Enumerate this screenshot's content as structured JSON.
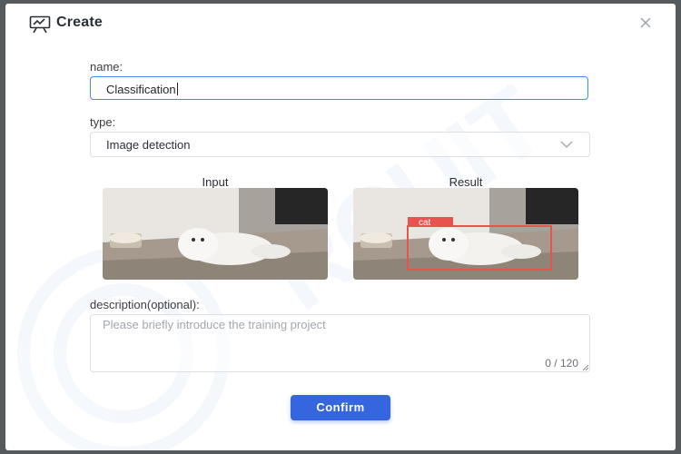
{
  "dialog": {
    "title": "Create",
    "header_icon": "presentation-chart-icon",
    "close_icon": "close-icon"
  },
  "form": {
    "name_label": "name:",
    "name_value": "Classification",
    "type_label": "type:",
    "type_value": "Image detection",
    "type_icon": "chevron-down-icon",
    "input_label": "Input",
    "result_label": "Result",
    "detection_label": "cat",
    "description_label": "description(optional):",
    "description_placeholder": "Please briefly introduce the training project",
    "description_counter": "0 / 120",
    "confirm_label": "Confirm"
  },
  "colors": {
    "accent": "#3566e0",
    "focus_border": "#3f8ef0",
    "detection_box": "#e8524f"
  }
}
